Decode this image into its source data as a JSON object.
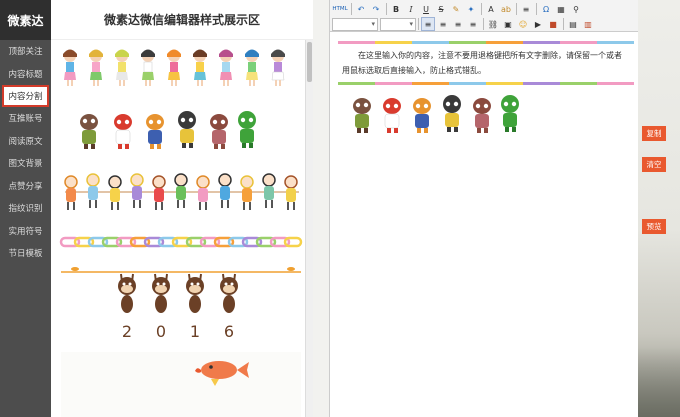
{
  "brand": "微素达",
  "panel_title": "微素达微信编辑器样式展示区",
  "nav": [
    {
      "label": "顶部关注",
      "active": false
    },
    {
      "label": "内容标题",
      "active": false
    },
    {
      "label": "内容分割",
      "active": true
    },
    {
      "label": "互推账号",
      "active": false
    },
    {
      "label": "阅读原文",
      "active": false
    },
    {
      "label": "图文背景",
      "active": false
    },
    {
      "label": "点赞分享",
      "active": false
    },
    {
      "label": "指纹识别",
      "active": false
    },
    {
      "label": "实用符号",
      "active": false
    },
    {
      "label": "节日模板",
      "active": false
    }
  ],
  "editor": {
    "text": "在这里输入你的内容，注意不要用退格键把所有文字删除，请保留一个或者用鼠标选取后直接输入，防止格式错乱。",
    "toolbar_html": "HTML"
  },
  "side_buttons": {
    "copy": "复制",
    "clear": "清空",
    "preview": "预览"
  },
  "year_digits": [
    "2",
    "0",
    "1",
    "6"
  ],
  "colors": {
    "accent": "#e9592f",
    "nav_bg": "#4d4d4d",
    "active_border": "#d33b2a"
  }
}
